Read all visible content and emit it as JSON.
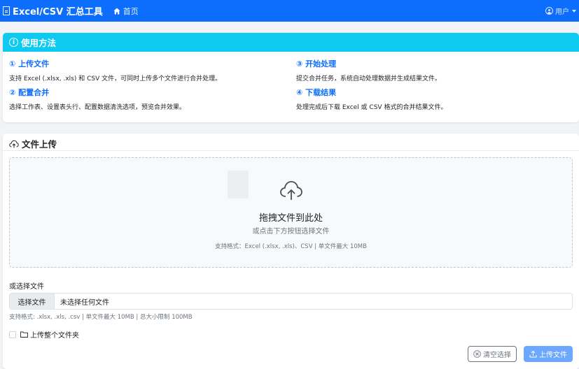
{
  "navbar": {
    "brand": "Excel/CSV 汇总工具",
    "home": "首页",
    "user": "用户",
    "accent": "#0d6efd"
  },
  "usage": {
    "title": "使用方法",
    "header_color": "#0dcaf0",
    "steps": [
      {
        "title": "① 上传文件",
        "desc": "支持 Excel (.xlsx, .xls) 和 CSV 文件，可同时上传多个文件进行合并处理。"
      },
      {
        "title": "② 配置合并",
        "desc": "选择工作表、设置表头行、配置数据清洗选项，预览合并效果。"
      },
      {
        "title": "③ 开始处理",
        "desc": "提交合并任务，系统自动处理数据并生成结果文件。"
      },
      {
        "title": "④ 下载结果",
        "desc": "处理完成后下载 Excel 或 CSV 格式的合并结果文件。"
      }
    ]
  },
  "upload": {
    "title": "文件上传",
    "dropzone_title": "拖拽文件到此处",
    "dropzone_sub": "或点击下方按钮选择文件",
    "dropzone_formats": "支持格式：Excel (.xlsx, .xls)、CSV | 单文件最大 10MB",
    "or_label": "或选择文件",
    "choose_button": "选择文件",
    "no_file": "未选择任何文件",
    "support_text": "支持格式: .xlsx, .xls, .csv | 单文件最大 10MB | 总大小限制 100MB",
    "folder_label": "上传整个文件夹",
    "clear_button": "清空选择",
    "upload_button": "上传文件"
  }
}
